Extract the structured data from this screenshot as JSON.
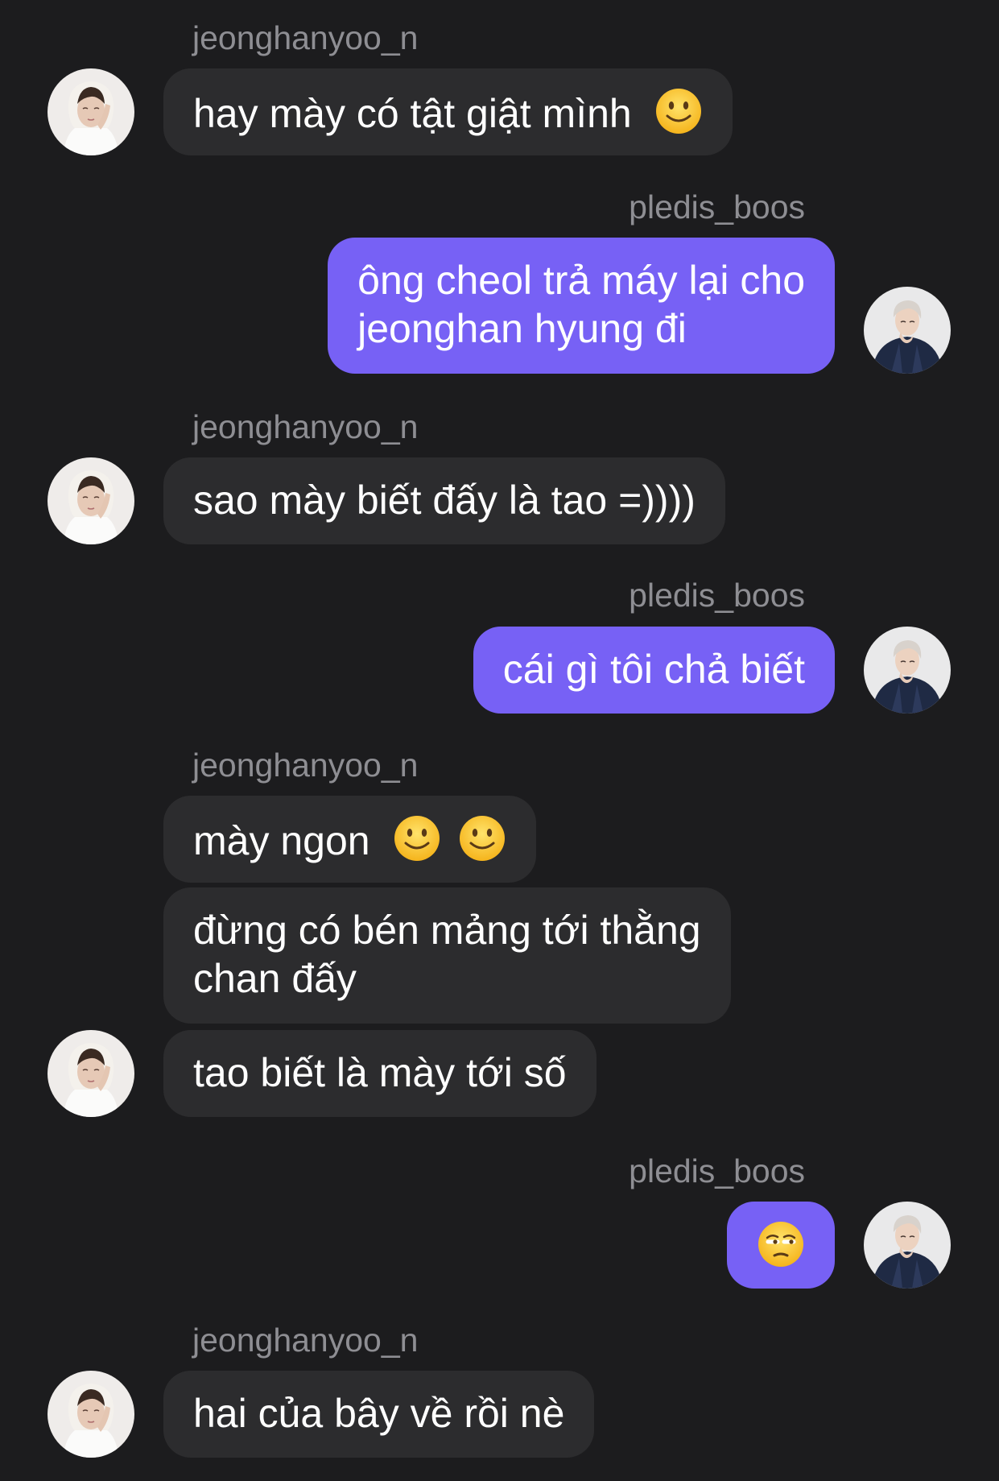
{
  "users": {
    "other": "jeonghanyoo_n",
    "me": "pledis_boos"
  },
  "messages": {
    "m1": "hay mày có tật giật mình",
    "m2_line1": "ông cheol trả máy lại cho",
    "m2_line2": "jeonghan hyung đi",
    "m3": "sao mày biết đấy là tao =))))",
    "m4": "cái gì tôi chả biết",
    "m5": "mày ngon",
    "m6_line1": "đừng có bén mảng tới thằng",
    "m6_line2": "chan đấy",
    "m7": "tao biết là mày tới số",
    "m9": "hai của bây về rồi nè"
  },
  "emoji": {
    "m1": "slightly-smiling-face",
    "m5": [
      "slightly-smiling-face",
      "slightly-smiling-face"
    ],
    "m8": "unamused-face"
  },
  "colors": {
    "background": "#1c1c1e",
    "incoming_bubble": "#2c2c2e",
    "outgoing_bubble": "#7761f5",
    "username": "#8e8e93",
    "text": "#ffffff"
  }
}
